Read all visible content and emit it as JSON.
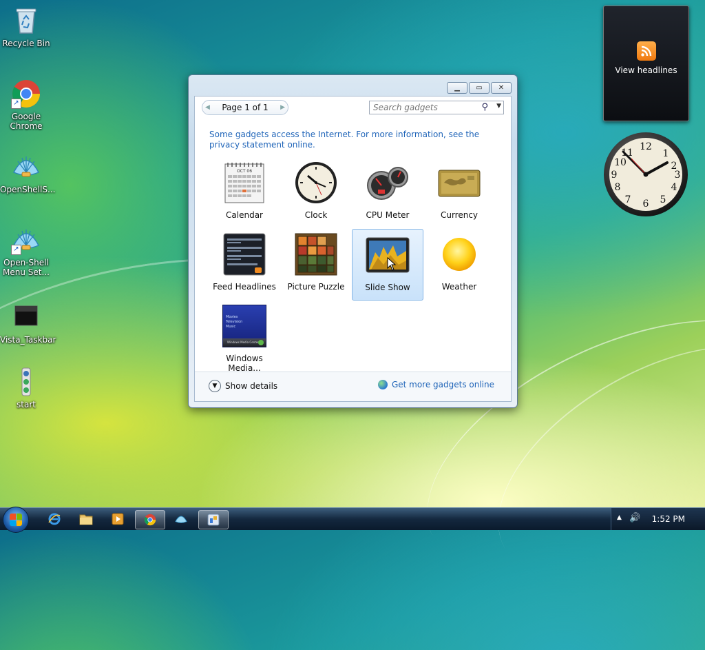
{
  "desktop": {
    "icons": [
      {
        "label": "Recycle Bin"
      },
      {
        "label": "Google Chrome"
      },
      {
        "label": "OpenShellS..."
      },
      {
        "label": "Open-Shell Menu Set..."
      },
      {
        "label": "Vista_Taskbar"
      },
      {
        "label": "start"
      }
    ]
  },
  "gadgets_window": {
    "pager": {
      "text": "Page 1 of 1"
    },
    "search": {
      "placeholder": "Search gadgets"
    },
    "info_text": "Some gadgets access the Internet.  For more information, see the privacy statement online.",
    "gadgets": [
      {
        "label": "Calendar"
      },
      {
        "label": "Clock"
      },
      {
        "label": "CPU Meter"
      },
      {
        "label": "Currency"
      },
      {
        "label": "Feed Headlines"
      },
      {
        "label": "Picture Puzzle"
      },
      {
        "label": "Slide Show"
      },
      {
        "label": "Weather"
      },
      {
        "label": "Windows Media..."
      }
    ],
    "calendar_month": "OCT 06",
    "media_menu": [
      "Movies",
      "Television",
      "Music"
    ],
    "media_bar": "Windows Media Center",
    "show_details": "Show details",
    "more_online": "Get more gadgets online"
  },
  "feed_gadget": {
    "label": "View headlines"
  },
  "taskbar": {
    "time": "1:52 PM"
  },
  "colors": {
    "accent_link": "#1f64b8",
    "selection": "#c9e2fa",
    "rss_orange": "#f07a10"
  }
}
